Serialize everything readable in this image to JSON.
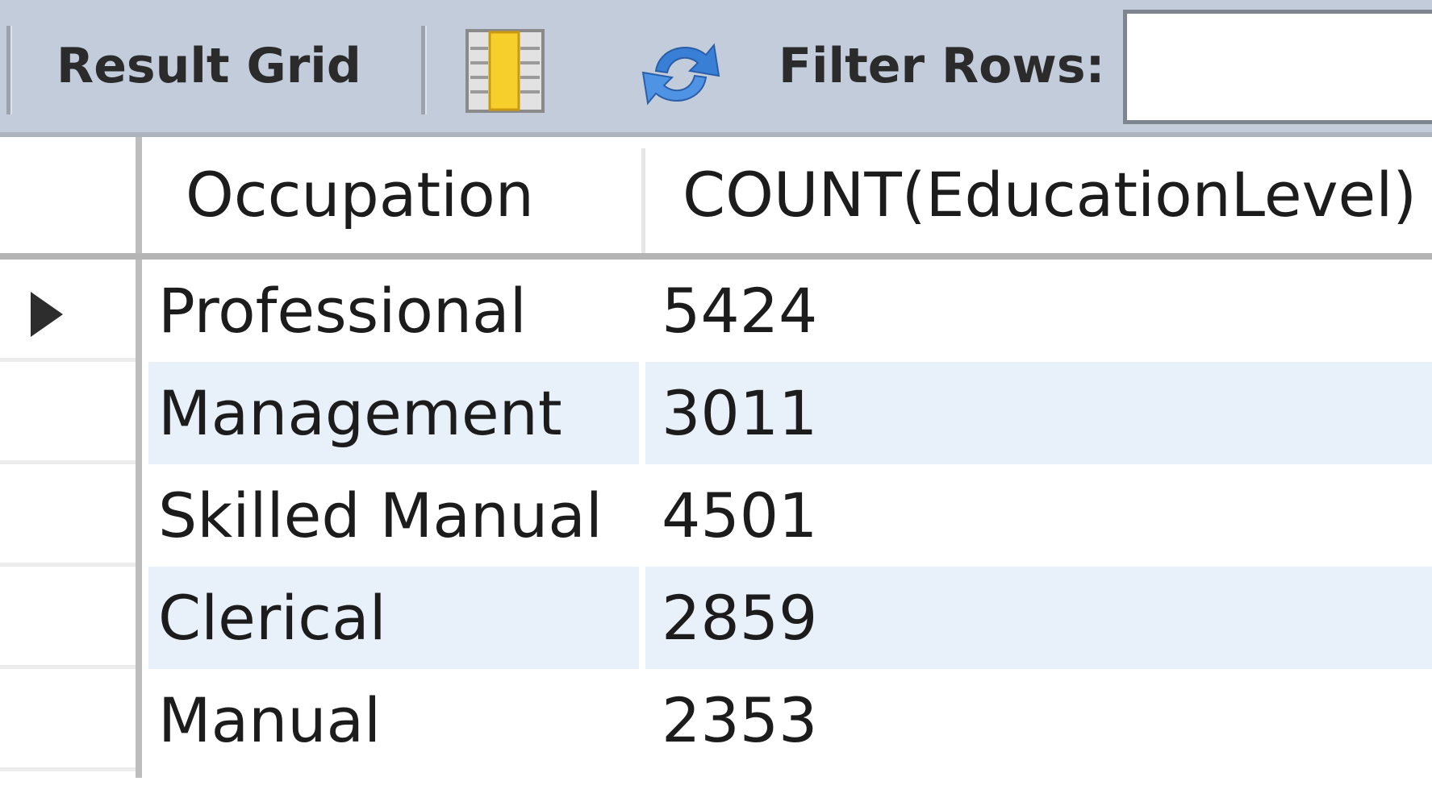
{
  "toolbar": {
    "result_grid_label": "Result Grid",
    "filter_label": "Filter Rows:",
    "filter_value": "",
    "icons": [
      "grid-layout-icon",
      "refresh-icon"
    ]
  },
  "grid": {
    "columns": [
      "Occupation",
      "COUNT(EducationLevel)"
    ],
    "rows": [
      {
        "occupation": "Professional",
        "count": "5424",
        "selected": true
      },
      {
        "occupation": "Management",
        "count": "3011"
      },
      {
        "occupation": "Skilled Manual",
        "count": "4501"
      },
      {
        "occupation": "Clerical",
        "count": "2859"
      },
      {
        "occupation": "Manual",
        "count": "2353"
      }
    ]
  },
  "colors": {
    "toolbar_bg": "#c3ccda",
    "alt_row_bg": "#e8f0fa",
    "refresh_icon": "#3a7fd6",
    "grid_icon_accent": "#f7cf2c"
  }
}
